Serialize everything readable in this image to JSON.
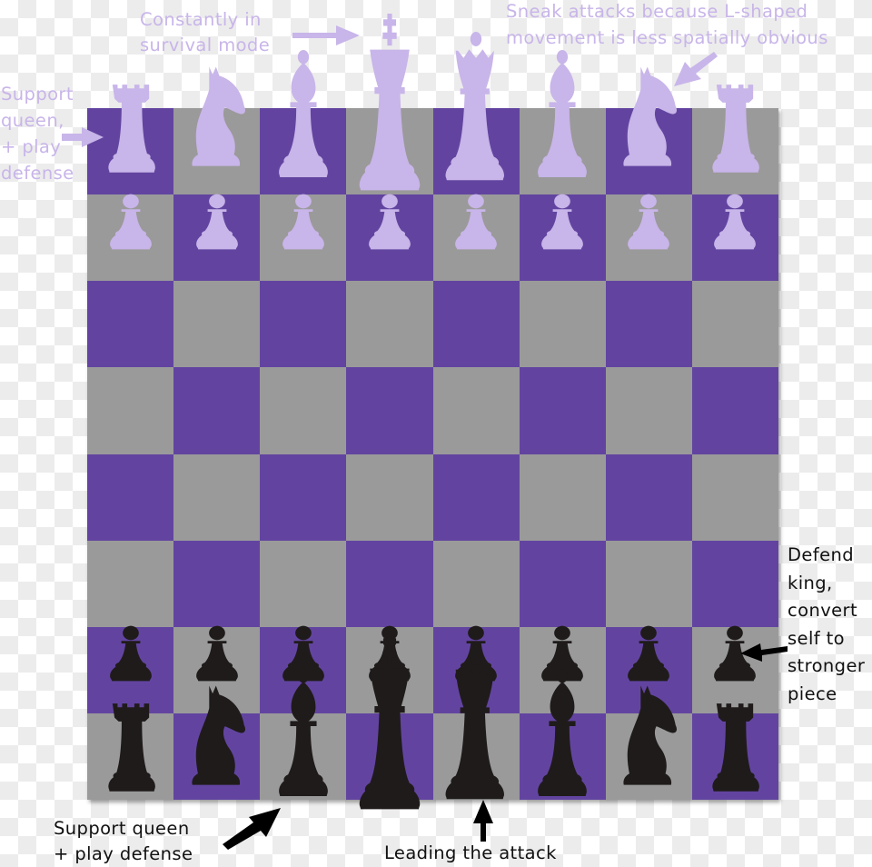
{
  "colors": {
    "dark_square": "#6244a0",
    "light_square": "#9a9a9a",
    "light_pieces": "#c8b5e9",
    "dark_pieces": "#1f1b1b",
    "annotation_light": "#c8b5e9",
    "annotation_dark": "#111111"
  },
  "board": {
    "size": 8,
    "top_left_square": "dark"
  },
  "pieces": {
    "light_back_rank": [
      "rook",
      "knight",
      "bishop",
      "king",
      "queen",
      "bishop",
      "knight",
      "rook"
    ],
    "light_pawns": [
      "pawn",
      "pawn",
      "pawn",
      "pawn",
      "pawn",
      "pawn",
      "pawn",
      "pawn"
    ],
    "dark_pawns": [
      "pawn",
      "pawn",
      "pawn",
      "pawn",
      "pawn",
      "pawn",
      "pawn",
      "pawn"
    ],
    "dark_back_rank": [
      "rook",
      "knight",
      "bishop",
      "king",
      "queen",
      "bishop",
      "knight",
      "rook"
    ]
  },
  "annotations": {
    "king": "Constantly in\nsurvival mode",
    "knight": "Sneak attacks because L-shaped\nmovement is less spatially obvious",
    "rook_light": "Support\nqueen,\n+ play\ndefense",
    "pawn": "Defend\nking,\nconvert\nself to\nstronger\npiece",
    "rook_dark": "Support queen\n+ play defense",
    "queen": "Leading the attack"
  }
}
